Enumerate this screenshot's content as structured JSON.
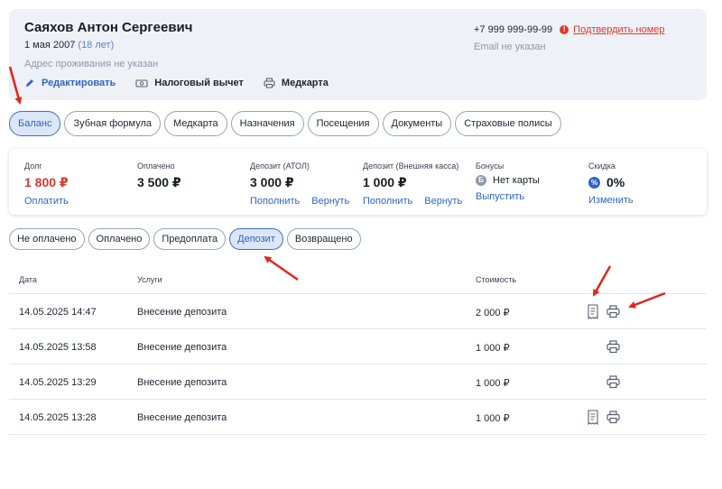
{
  "patient": {
    "name": "Саяхов Антон Сергеевич",
    "birth_date": "1 мая 2007",
    "age": "(18 лет)",
    "address": "Адрес проживания не указан",
    "phone": "+7 999 999-99-99",
    "confirm_phone": "Подтвердить номер",
    "email": "Email не указан"
  },
  "actions": {
    "edit": "Редактировать",
    "tax": "Налоговый вычет",
    "medcard": "Медкарта"
  },
  "tabs": [
    "Баланс",
    "Зубная формула",
    "Медкарта",
    "Назначения",
    "Посещения",
    "Документы",
    "Страховые полисы"
  ],
  "active_tab": "Баланс",
  "balance": {
    "debt": {
      "label": "Долг",
      "value": "1 800 ₽",
      "link": "Оплатить"
    },
    "paid": {
      "label": "Оплачено",
      "value": "3 500 ₽"
    },
    "deposit_atol": {
      "label": "Депозит (АТОЛ)",
      "value": "3 000 ₽",
      "link1": "Пополнить",
      "link2": "Вернуть"
    },
    "deposit_cash": {
      "label": "Депозит (Внешняя касса)",
      "value": "1 000 ₽",
      "link1": "Пополнить",
      "link2": "Вернуть"
    },
    "bonus": {
      "label": "Бонусы",
      "badge": "Б",
      "value": "Нет карты",
      "link": "Выпустить"
    },
    "discount": {
      "label": "Скидка",
      "badge": "%",
      "value": "0%",
      "link": "Изменить"
    }
  },
  "filters": [
    "Не оплачено",
    "Оплачено",
    "Предоплата",
    "Депозит",
    "Возвращено"
  ],
  "active_filter": "Депозит",
  "table": {
    "headers": {
      "date": "Дата",
      "service": "Услуги",
      "cost": "Стоимость"
    },
    "rows": [
      {
        "date": "14.05.2025 14:47",
        "service": "Внесение депозита",
        "cost": "2 000 ₽",
        "receipt": true
      },
      {
        "date": "14.05.2025 13:58",
        "service": "Внесение депозита",
        "cost": "1 000 ₽",
        "receipt": false
      },
      {
        "date": "14.05.2025 13:29",
        "service": "Внесение депозита",
        "cost": "1 000 ₽",
        "receipt": false
      },
      {
        "date": "14.05.2025 13:28",
        "service": "Внесение депозита",
        "cost": "1 000 ₽",
        "receipt": true
      }
    ]
  },
  "colors": {
    "accent": "#2f63c9",
    "danger": "#e0372e",
    "annotation": "#e0261c"
  }
}
